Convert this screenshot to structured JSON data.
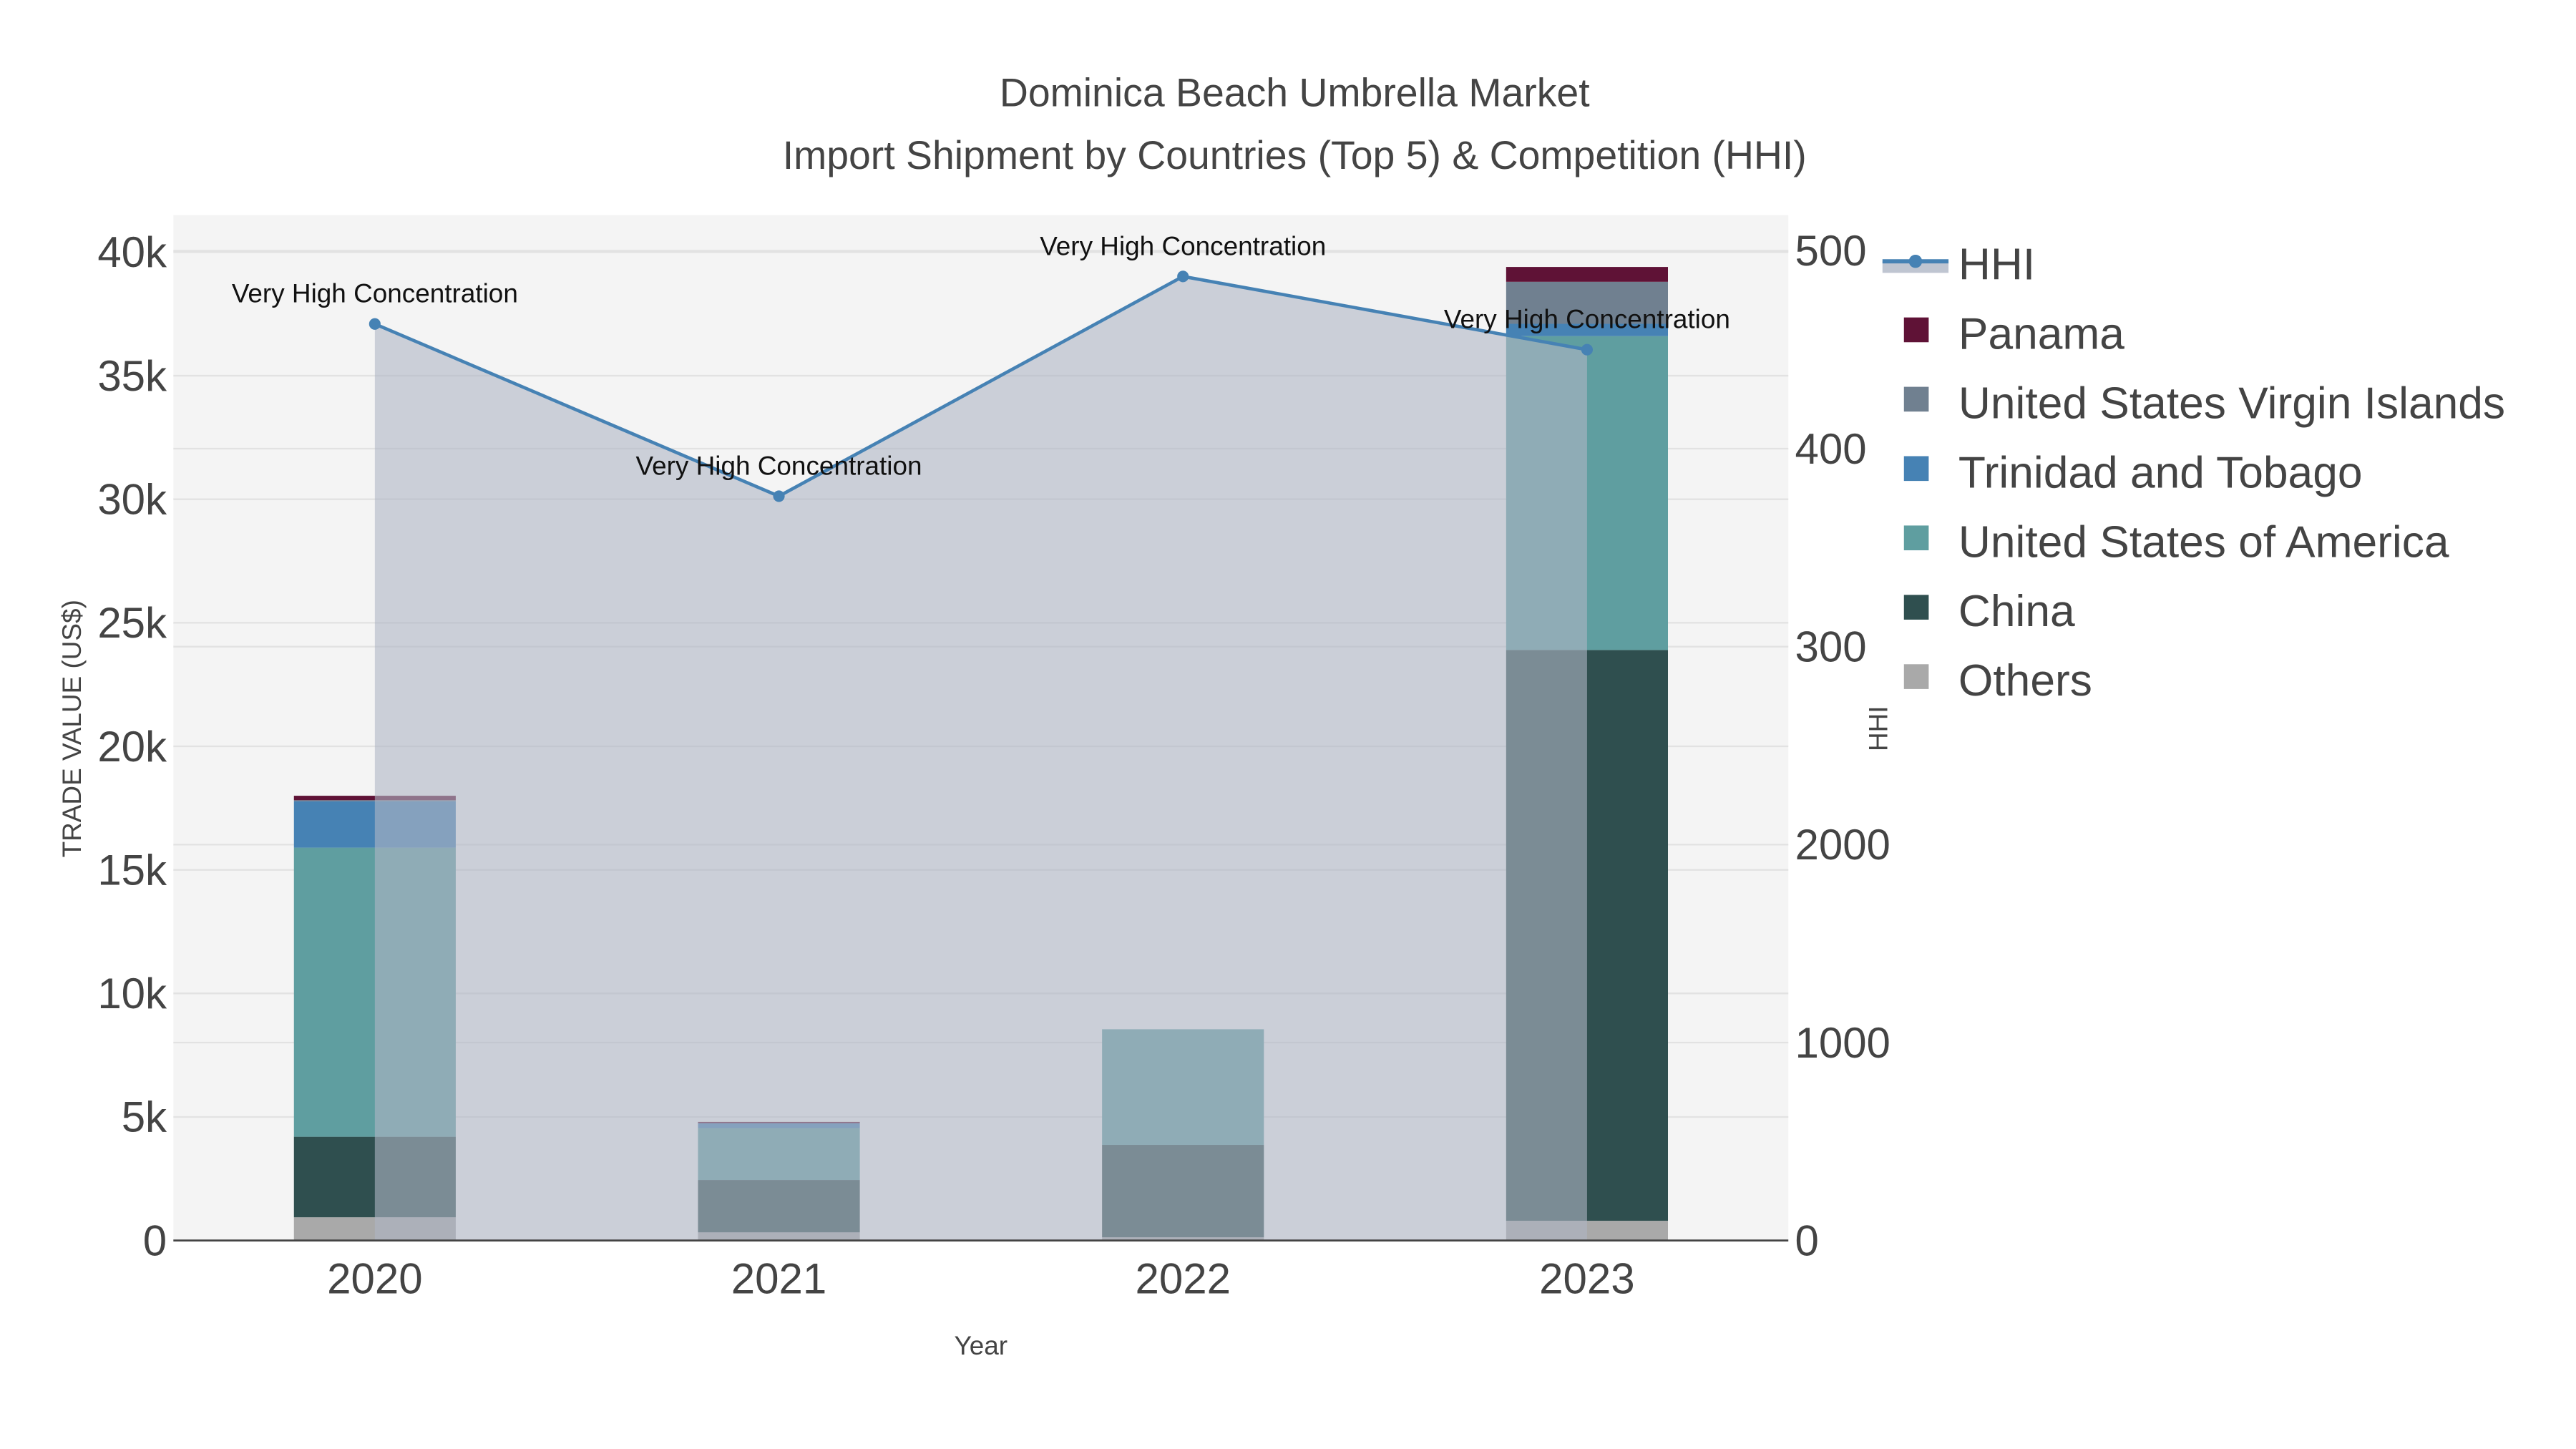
{
  "chart_data": {
    "type": "bar",
    "title": "Dominica Beach Umbrella Market",
    "subtitle": "Import Shipment by Countries (Top 5) & Competition (HHI)",
    "xlabel": "Year",
    "ylabel": "TRADE VALUE (US$)",
    "y2label": "HHI",
    "categories": [
      "2020",
      "2021",
      "2022",
      "2023"
    ],
    "ylim": [
      0,
      41500
    ],
    "yticks": [
      0,
      5000,
      10000,
      15000,
      20000,
      25000,
      30000,
      35000,
      40000
    ],
    "ytick_labels": [
      "0",
      "5k",
      "10k",
      "15k",
      "20k",
      "25k",
      "30k",
      "35k",
      "40k"
    ],
    "y2ticks": [
      0,
      100,
      200,
      300,
      400,
      500
    ],
    "y2tick_labels": [
      "0",
      "1000",
      "2000",
      "300",
      "400",
      "500"
    ],
    "y2lim": [
      0,
      518
    ],
    "series": [
      {
        "name": "Others",
        "color": "#a9a9a9",
        "values": [
          940,
          330,
          130,
          800
        ]
      },
      {
        "name": "China",
        "color": "#2f4f4f",
        "values": [
          3260,
          2120,
          3740,
          23100
        ]
      },
      {
        "name": "United States of America",
        "color": "#5f9ea0",
        "values": [
          11700,
          2100,
          4680,
          12700
        ]
      },
      {
        "name": "Trinidad and Tobago",
        "color": "#4682b4",
        "values": [
          1880,
          200,
          0,
          500
        ]
      },
      {
        "name": "United States Virgin Islands",
        "color": "#708090",
        "values": [
          40,
          0,
          0,
          1700
        ]
      },
      {
        "name": "Panama",
        "color": "#5f1236",
        "values": [
          180,
          50,
          0,
          600
        ]
      }
    ],
    "hhi": {
      "name": "HHI",
      "color": "#4682b4",
      "values": [
        463,
        376,
        487,
        450
      ],
      "annotations": [
        "Very High Concentration",
        "Very High Concentration",
        "Very High Concentration",
        "Very High Concentration"
      ]
    },
    "legend": [
      "HHI",
      "Panama",
      "United States Virgin Islands",
      "Trinidad and Tobago",
      "United States of America",
      "China",
      "Others"
    ],
    "legend_placement": "right",
    "grid": true
  }
}
